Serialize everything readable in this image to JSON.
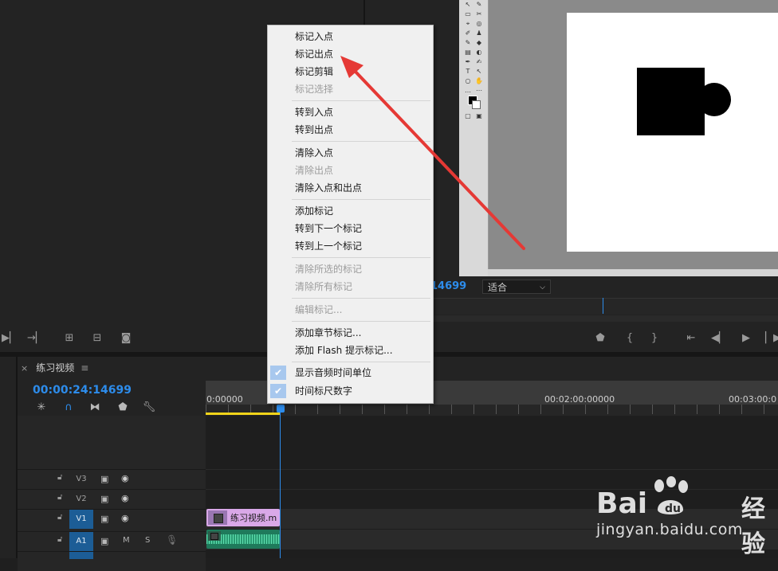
{
  "program_monitor": {
    "timecode_fragment": "14699",
    "fit_select": "适合"
  },
  "timeline": {
    "tab_label": "练习视频",
    "timecode": "00:00:24:14699",
    "ruler_labels": [
      "0:00000",
      "00:02:00:00000",
      "00:03:00:0"
    ],
    "tracks": [
      {
        "name": "V3"
      },
      {
        "name": "V2"
      },
      {
        "name": "V1"
      },
      {
        "name": "A1",
        "m": "M",
        "s": "S"
      }
    ],
    "clip_label": "练习视频.m"
  },
  "context_menu": {
    "items": [
      {
        "label": "标记入点",
        "enabled": true
      },
      {
        "label": "标记出点",
        "enabled": true
      },
      {
        "label": "标记剪辑",
        "enabled": true
      },
      {
        "label": "标记选择",
        "enabled": false
      },
      {
        "label": "转到入点",
        "enabled": true
      },
      {
        "label": "转到出点",
        "enabled": true
      },
      {
        "label": "清除入点",
        "enabled": true
      },
      {
        "label": "清除出点",
        "enabled": false
      },
      {
        "label": "清除入点和出点",
        "enabled": true
      },
      {
        "label": "添加标记",
        "enabled": true
      },
      {
        "label": "转到下一个标记",
        "enabled": true
      },
      {
        "label": "转到上一个标记",
        "enabled": true
      },
      {
        "label": "清除所选的标记",
        "enabled": false
      },
      {
        "label": "清除所有标记",
        "enabled": false
      },
      {
        "label": "编辑标记...",
        "enabled": false
      },
      {
        "label": "添加章节标记...",
        "enabled": true
      },
      {
        "label": "添加 Flash 提示标记...",
        "enabled": true
      },
      {
        "label": "显示音频时间单位",
        "enabled": true,
        "checked": true
      },
      {
        "label": "时间标尺数字",
        "enabled": true,
        "checked": true
      }
    ]
  },
  "watermark": {
    "brand_left": "Bai",
    "brand_right": "经验",
    "url": "jingyan.baidu.com"
  },
  "icons": {
    "arrow_color": "#e53935",
    "accent_blue": "#2d8ceb"
  }
}
